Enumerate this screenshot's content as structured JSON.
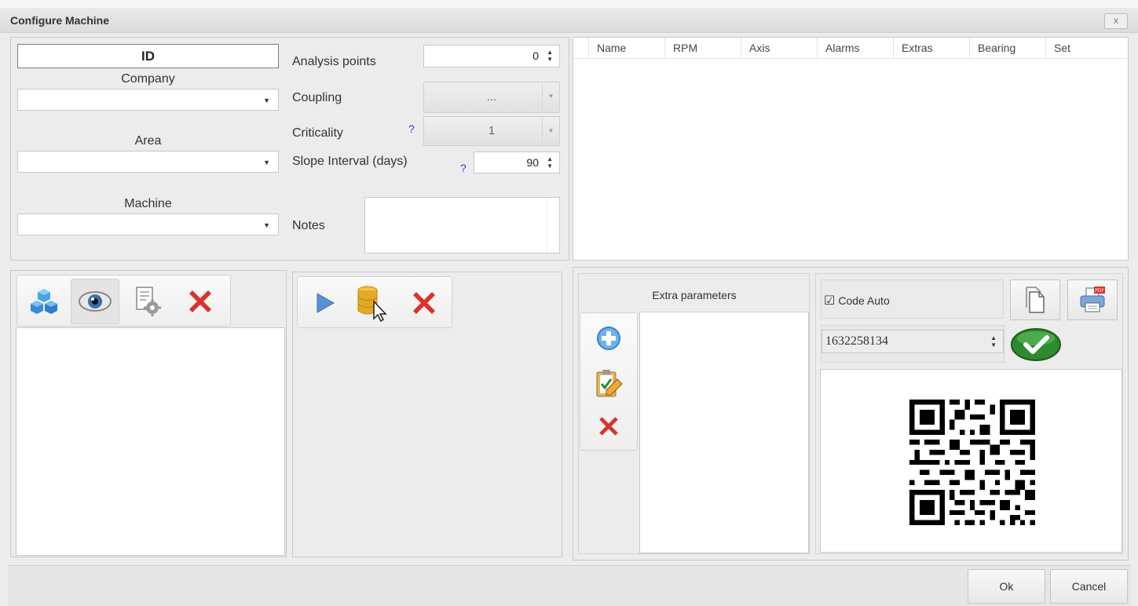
{
  "window": {
    "title": "Configure Machine",
    "close_label": "x"
  },
  "form": {
    "id_label": "ID",
    "company_label": "Company",
    "company_value": "",
    "area_label": "Area",
    "area_value": "",
    "machine_label": "Machine",
    "machine_value": "",
    "analysis_points_label": "Analysis points",
    "analysis_points_value": "0",
    "coupling_label": "Coupling",
    "coupling_value": "...",
    "criticality_label": "Criticality",
    "criticality_help": "?",
    "criticality_value": "1",
    "slope_label": "Slope Interval (days)",
    "slope_help": "?",
    "slope_value": "90",
    "notes_label": "Notes",
    "notes_value": ""
  },
  "grid": {
    "columns": [
      "Name",
      "RPM",
      "Axis",
      "Alarms",
      "Extras",
      "Bearing",
      "Set"
    ]
  },
  "toolbar1": {
    "icons": [
      "cubes-icon",
      "eye-icon",
      "settings-page-icon",
      "delete-icon"
    ]
  },
  "toolbar2": {
    "icons": [
      "play-icon",
      "database-select-icon",
      "delete-icon"
    ]
  },
  "extras": {
    "title": "Extra parameters",
    "icons": [
      "add-icon",
      "edit-clipboard-icon",
      "delete-icon"
    ]
  },
  "code": {
    "auto_label": "Code Auto",
    "auto_checked": true,
    "value": "1632258134",
    "icons": [
      "copy-icon",
      "print-pdf-icon",
      "confirm-icon",
      "qr-code-icon"
    ]
  },
  "footer": {
    "ok_label": "Ok",
    "cancel_label": "Cancel"
  },
  "colors": {
    "delete": "#d9332b",
    "confirm": "#2d8a2e",
    "play": "#5b8fd6",
    "accent_blue": "#2a3fd1"
  }
}
